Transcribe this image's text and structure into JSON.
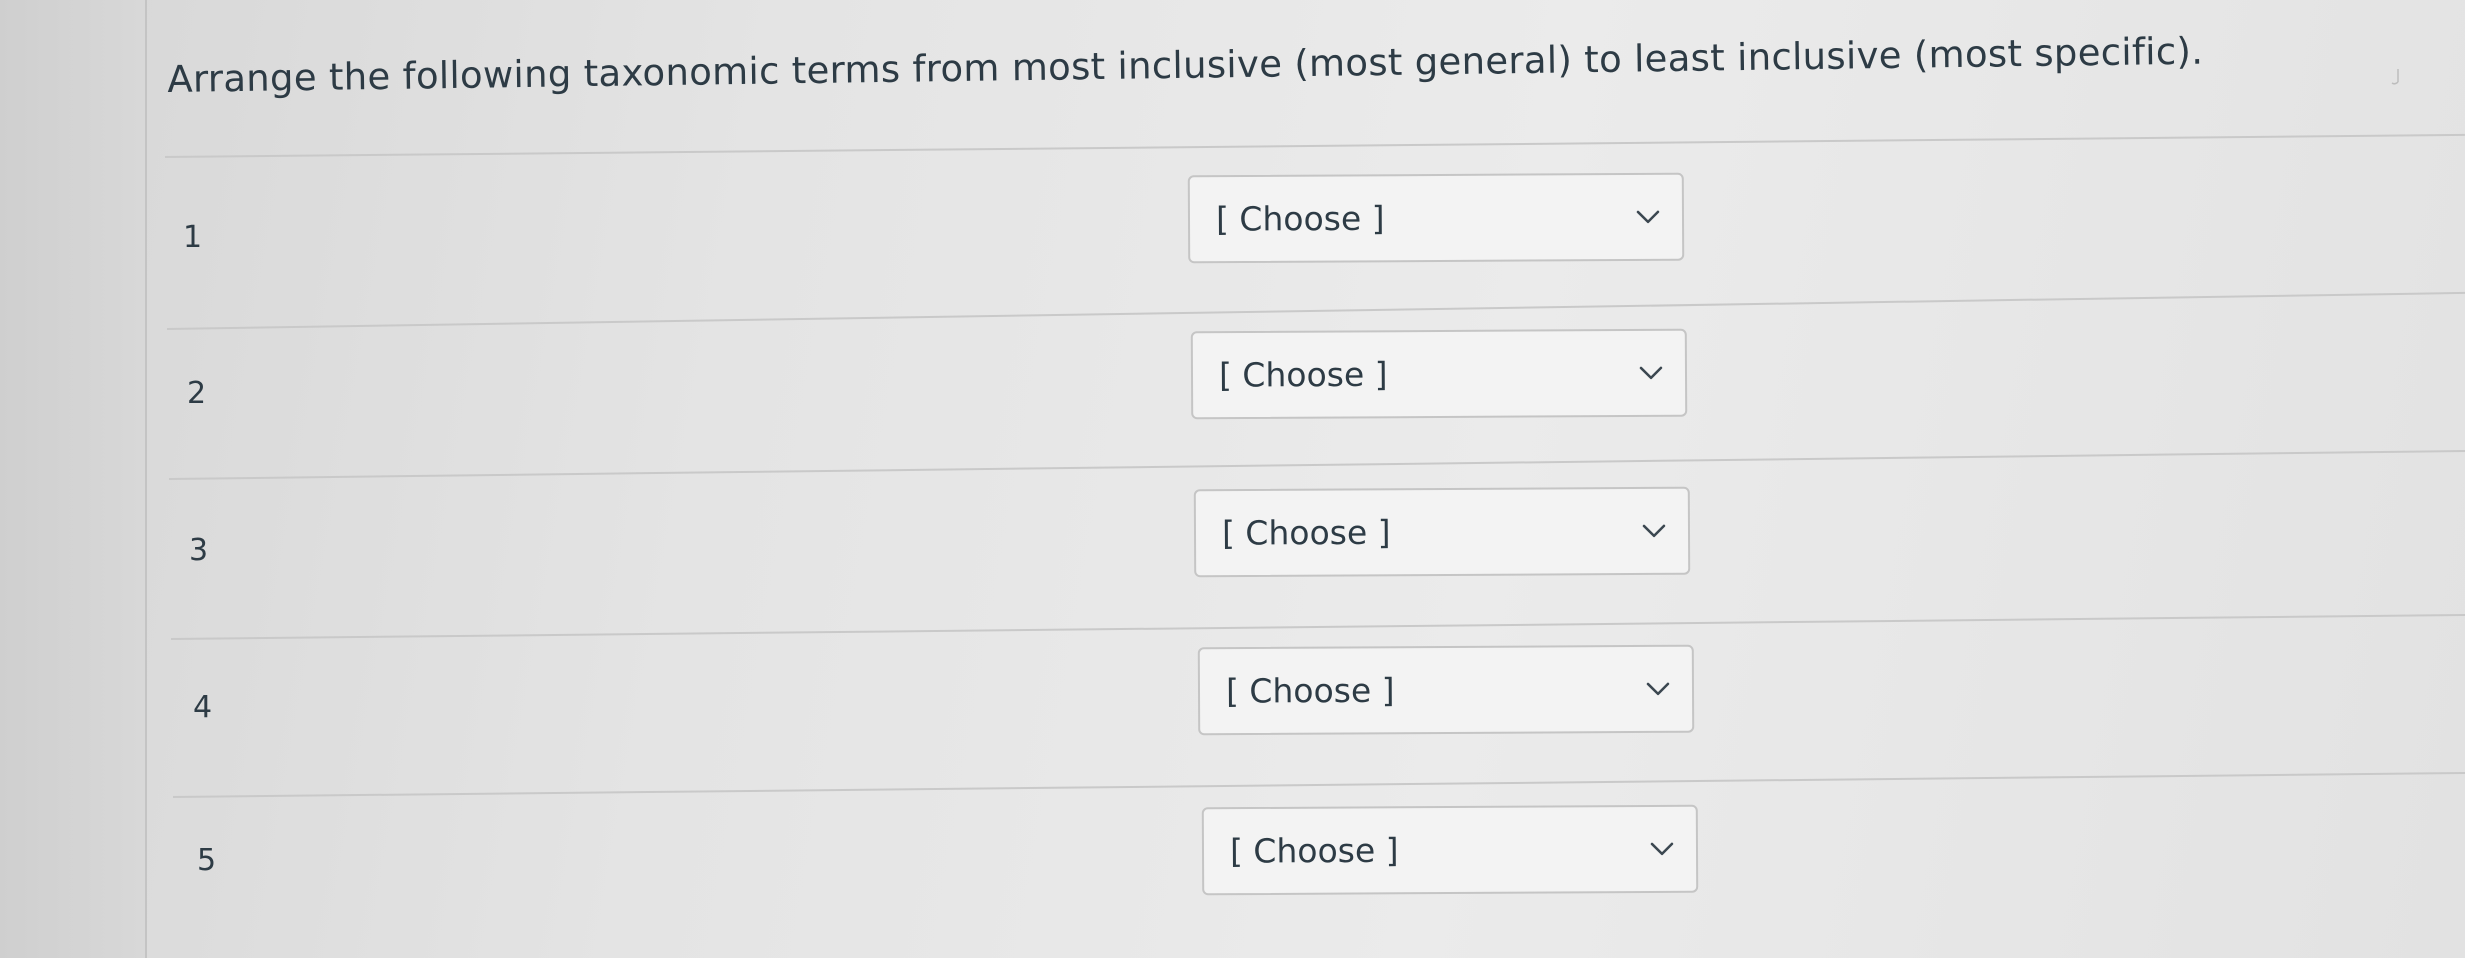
{
  "question": {
    "text": "Arrange the following taxonomic terms from most inclusive (most general) to least inclusive (most specific)."
  },
  "rows": [
    {
      "number": "1",
      "select": {
        "value": "[ Choose ]"
      }
    },
    {
      "number": "2",
      "select": {
        "value": "[ Choose ]"
      }
    },
    {
      "number": "3",
      "select": {
        "value": "[ Choose ]"
      }
    },
    {
      "number": "4",
      "select": {
        "value": "[ Choose ]"
      }
    },
    {
      "number": "5",
      "select": {
        "value": "[ Choose ]"
      }
    }
  ],
  "icons": {
    "select_arrow": "chevron-down-icon"
  },
  "colors": {
    "text": "#2d3b45",
    "select_border": "#c5c5c5",
    "divider": "#c9c9c9"
  }
}
